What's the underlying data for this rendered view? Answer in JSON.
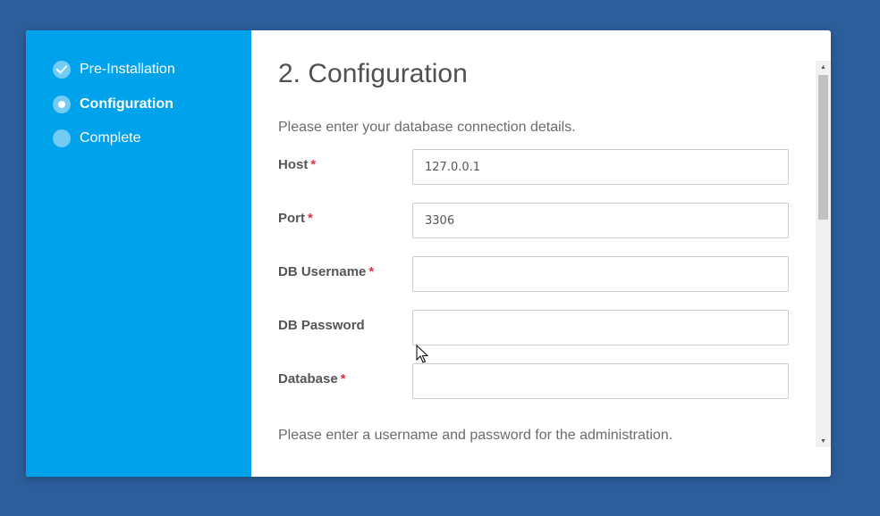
{
  "steps": [
    {
      "label": "Pre-Installation",
      "state": "done",
      "icon": "check-icon"
    },
    {
      "label": "Configuration",
      "state": "active",
      "icon": "current-step-icon"
    },
    {
      "label": "Complete",
      "state": "pending",
      "icon": "pending-step-icon"
    }
  ],
  "main": {
    "title": "2. Configuration",
    "intro": "Please enter your database connection details.",
    "required_marker": "*",
    "fields": [
      {
        "label": "Host",
        "required": true,
        "value": "127.0.0.1"
      },
      {
        "label": "Port",
        "required": true,
        "value": "3306"
      },
      {
        "label": "DB Username",
        "required": true,
        "value": ""
      },
      {
        "label": "DB Password",
        "required": false,
        "value": ""
      },
      {
        "label": "Database",
        "required": true,
        "value": ""
      }
    ],
    "admin_intro": "Please enter a username and password for the administration."
  },
  "colors": {
    "background": "#2d5e9c",
    "sidebar": "#00a2ec",
    "required": "#e0334a"
  }
}
